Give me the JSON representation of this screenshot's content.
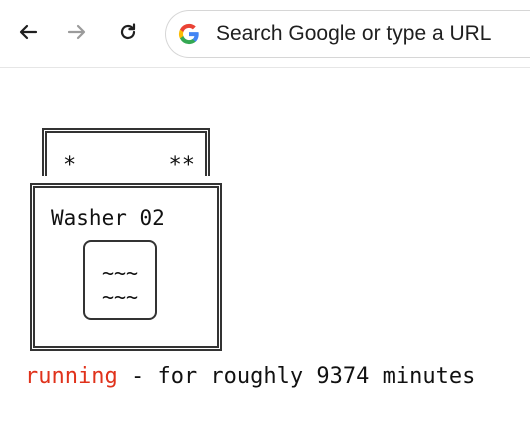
{
  "toolbar": {
    "back_icon": "back-arrow-icon",
    "forward_icon": "forward-arrow-icon",
    "reload_icon": "reload-icon",
    "search_placeholder": "Search Google or type a URL",
    "google_icon": "google-g-icon"
  },
  "washer": {
    "lid_left_star": "*",
    "lid_right_stars": "**",
    "name": "Washer 02",
    "wave_top": "~~~",
    "wave_bottom": "~~~"
  },
  "status": {
    "state": "running",
    "separator": " - for roughly ",
    "minutes": "9374",
    "unit": " minutes"
  },
  "colors": {
    "running": "#e0321b",
    "text": "#111111",
    "border": "#333333"
  }
}
